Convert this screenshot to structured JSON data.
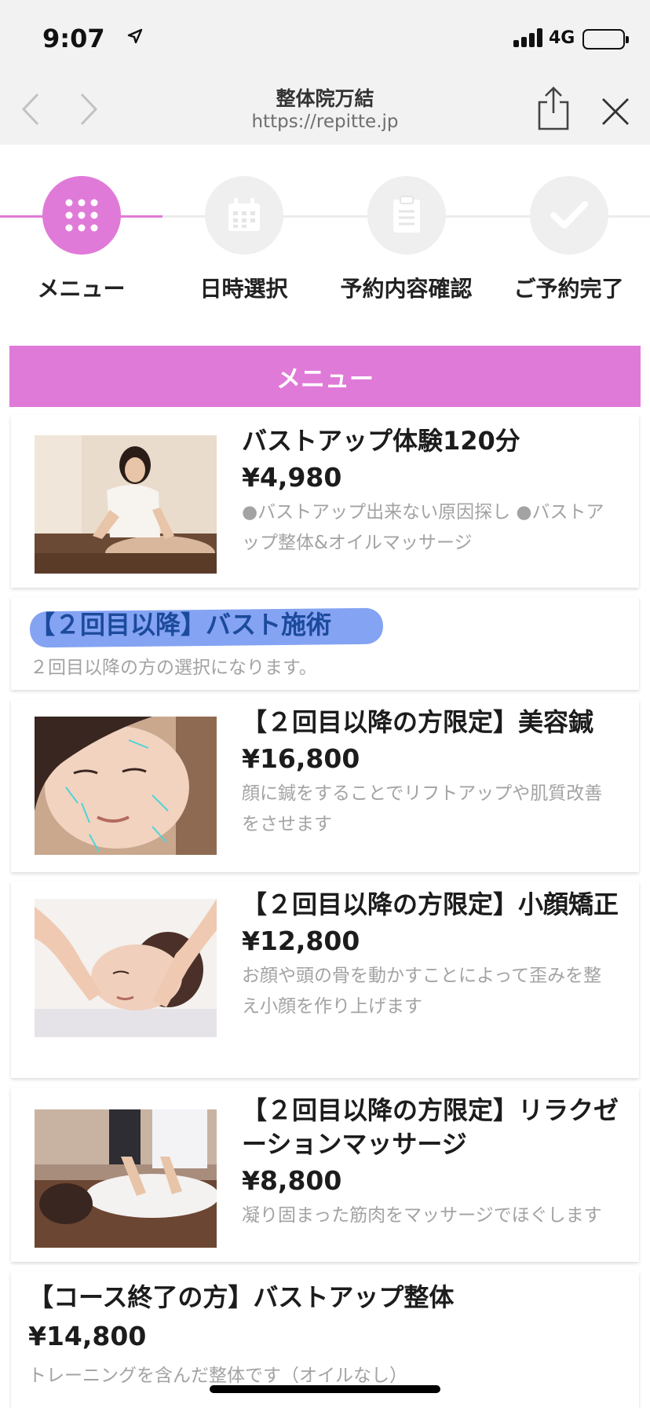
{
  "status_bar": {
    "time": "9:07",
    "network": "4G",
    "battery": 1.0
  },
  "browser": {
    "title": "整体院万結",
    "url": "https://repitte.jp"
  },
  "stepper": {
    "active_index": 0,
    "accent": "#e07ad8",
    "steps": [
      {
        "label": "メニュー",
        "icon": "grid-icon"
      },
      {
        "label": "日時選択",
        "icon": "calendar-icon"
      },
      {
        "label": "予約内容確認",
        "icon": "clipboard-icon"
      },
      {
        "label": "ご予約完了",
        "icon": "check-icon"
      }
    ]
  },
  "menu_header": "メニュー",
  "items": [
    {
      "name": "バストアップ体験120分",
      "price": "¥4,980",
      "desc": "●バストアップ出来ない原因探し ●バストアップ整体&オイルマッサージ",
      "image": "woman-treating-client-photo"
    },
    {
      "category_title": "【２回目以降】バスト施術",
      "category_sub": "２回目以降の方の選択になります。"
    },
    {
      "name": "【２回目以降の方限定】美容鍼",
      "price": "¥16,800",
      "desc": "顔に鍼をすることでリフトアップや肌質改善をさせます",
      "image": "acupuncture-face-photo"
    },
    {
      "name": "【２回目以降の方限定】小顔矯正",
      "price": "¥12,800",
      "desc": "お顔や頭の骨を動かすことによって歪みを整え小顔を作り上げます",
      "image": "face-massage-photo"
    },
    {
      "name": "【２回目以降の方限定】リラクゼーションマッサージ",
      "price": "¥8,800",
      "desc": "凝り固まった筋肉をマッサージでほぐします",
      "image": "back-massage-photo"
    },
    {
      "name": "【コース終了の方】バストアップ整体",
      "price": "¥14,800",
      "desc": "トレーニングを含んだ整体です（オイルなし）"
    }
  ]
}
